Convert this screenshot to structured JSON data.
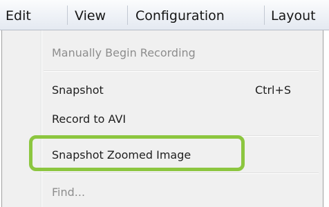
{
  "menubar": {
    "items": [
      {
        "label": "Edit"
      },
      {
        "label": "View"
      },
      {
        "label": "Configuration"
      },
      {
        "label": "Layout"
      }
    ]
  },
  "dropdown": {
    "items": [
      {
        "label": "Manually Begin Recording",
        "enabled": false
      },
      {
        "label": "Snapshot",
        "shortcut": "Ctrl+S",
        "enabled": true
      },
      {
        "label": "Record to AVI",
        "enabled": true
      },
      {
        "label": "Snapshot Zoomed Image",
        "enabled": true,
        "highlighted": true
      },
      {
        "label": "Find...",
        "enabled": false
      }
    ]
  },
  "colors": {
    "highlight_border": "#8cc63f",
    "menu_background": "#f0f0f0",
    "disabled_text": "#8d8d8d"
  }
}
